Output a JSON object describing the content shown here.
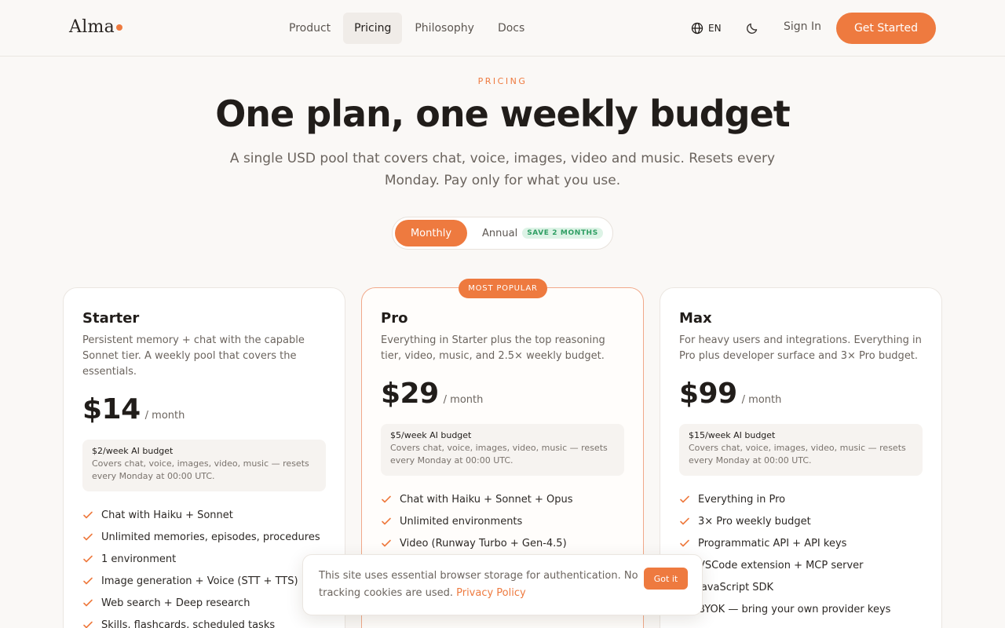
{
  "brand": {
    "name": "Alma",
    "accent": "#ee7a3f"
  },
  "nav": {
    "items": [
      {
        "label": "Product"
      },
      {
        "label": "Pricing",
        "active": true
      },
      {
        "label": "Philosophy"
      },
      {
        "label": "Docs"
      }
    ],
    "language": "EN",
    "language_icon": "globe-icon",
    "theme_icon": "moon-icon",
    "sign_in": "Sign In",
    "cta": "Get Started"
  },
  "hero": {
    "eyebrow": "PRICING",
    "title": "One plan, one weekly budget",
    "subtitle": "A single USD pool that covers chat, voice, images, video and music. Resets every Monday. Pay only for what you use."
  },
  "billing": {
    "monthly": "Monthly",
    "annual": "Annual",
    "save_badge": "SAVE 2 MONTHS",
    "selected": "Monthly"
  },
  "plans": [
    {
      "name": "Starter",
      "description": "Persistent memory + chat with the capable Sonnet tier. A weekly pool that covers the essentials.",
      "price": "$14",
      "period": "/ month",
      "budget_title": "$2/week AI budget",
      "budget_note": "Covers chat, voice, images, video, music — resets every Monday at 00:00 UTC.",
      "features": [
        "Chat with Haiku + Sonnet",
        "Unlimited memories, episodes, procedures",
        "1 environment",
        "Image generation + Voice (STT + TTS)",
        "Web search + Deep research",
        "Skills, flashcards, scheduled tasks"
      ]
    },
    {
      "name": "Pro",
      "badge": "MOST POPULAR",
      "description": "Everything in Starter plus the top reasoning tier, video, music, and 2.5× weekly budget.",
      "price": "$29",
      "period": "/ month",
      "budget_title": "$5/week AI budget",
      "budget_note": "Covers chat, voice, images, video, music — resets every Monday at 00:00 UTC.",
      "features": [
        "Chat with Haiku + Sonnet + Opus",
        "Unlimited environments",
        "Video (Runway Turbo + Gen-4.5)"
      ]
    },
    {
      "name": "Max",
      "description": "For heavy users and integrations. Everything in Pro plus developer surface and 3× Pro budget.",
      "price": "$99",
      "period": "/ month",
      "budget_title": "$15/week AI budget",
      "budget_note": "Covers chat, voice, images, video, music — resets every Monday at 00:00 UTC.",
      "features": [
        "Everything in Pro",
        "3× Pro weekly budget",
        "Programmatic API + API keys",
        "VSCode extension + MCP server",
        "JavaScript SDK",
        "BYOK — bring your own provider keys"
      ]
    }
  ],
  "cookie": {
    "text": "This site uses essential browser storage for authentication. No tracking cookies are used.",
    "link": "Privacy Policy",
    "button": "Got it"
  }
}
